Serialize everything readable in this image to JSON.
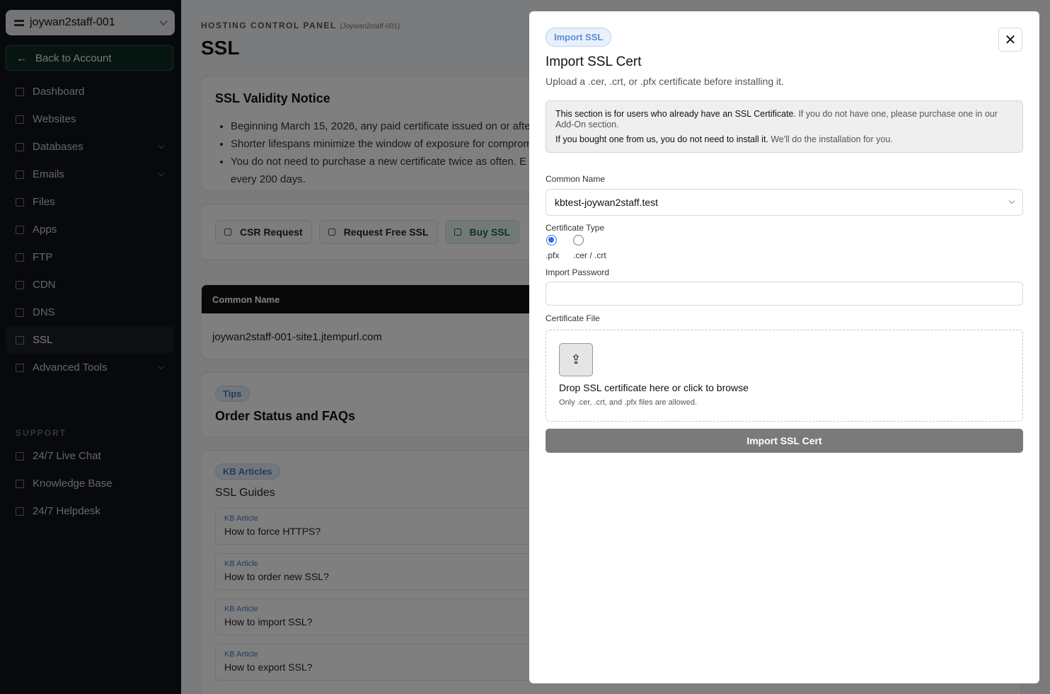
{
  "sidebar": {
    "account": "joywan2staff-001",
    "back": "Back to Account",
    "items": [
      {
        "label": "Dashboard",
        "expand": false
      },
      {
        "label": "Websites",
        "expand": false
      },
      {
        "label": "Databases",
        "expand": true
      },
      {
        "label": "Emails",
        "expand": true
      },
      {
        "label": "Files",
        "expand": false
      },
      {
        "label": "Apps",
        "expand": false
      },
      {
        "label": "FTP",
        "expand": false
      },
      {
        "label": "CDN",
        "expand": false
      },
      {
        "label": "DNS",
        "expand": false
      },
      {
        "label": "SSL",
        "expand": false,
        "active": true
      },
      {
        "label": "Advanced Tools",
        "expand": true
      }
    ],
    "support_heading": "SUPPORT",
    "support_items": [
      "24/7 Live Chat",
      "Knowledge Base",
      "24/7 Helpdesk"
    ]
  },
  "page": {
    "kicker": "HOSTING CONTROL PANEL",
    "kicker_account": "(Joywan2staff-001)",
    "title": "SSL",
    "notice": {
      "title": "SSL Validity Notice",
      "bullets": [
        "Beginning March 15, 2026, any paid certificate issued on or after",
        "Shorter lifespans minimize the window of exposure for compromi",
        "You do not need to purchase a new certificate twice as often. E",
        "every 200 days."
      ]
    },
    "actions": [
      "CSR Request",
      "Request Free SSL",
      "Buy SSL"
    ],
    "table": {
      "header": "Common Name",
      "row": "joywan2staff-001-site1.jtempurl.com"
    },
    "tips": {
      "pill": "Tips",
      "title": "Order Status and FAQs"
    },
    "kb": {
      "pill": "KB Articles",
      "title": "SSL Guides",
      "tag": "KB Article",
      "items": [
        "How to force HTTPS?",
        "How to order new SSL?",
        "How to import SSL?",
        "How to export SSL?"
      ]
    }
  },
  "modal": {
    "badge": "Import SSL",
    "close": "✕",
    "title": "Import SSL Cert",
    "subtitle": "Upload a .cer, .crt, or .pfx certificate before installing it.",
    "info_line1_strong": "This section is for users who already have an SSL Certificate.",
    "info_line1_rest": " If you do not have one, please purchase one in our Add-On section.",
    "info_line2_strong": "If you bought one from us, you do not need to install it.",
    "info_line2_rest": " We'll do the installation for you.",
    "common_name_label": "Common Name",
    "common_name_value": "kbtest-joywan2staff.test",
    "cert_type_label": "Certificate Type",
    "cert_type_options": [
      ".pfx",
      ".cer / .crt"
    ],
    "cert_type_selected": ".pfx",
    "password_label": "Import Password",
    "file_label": "Certificate File",
    "drop_title": "Drop SSL certificate here or click to browse",
    "drop_sub": "Only .cer, .crt, and .pfx files are allowed.",
    "submit": "Import SSL Cert"
  }
}
